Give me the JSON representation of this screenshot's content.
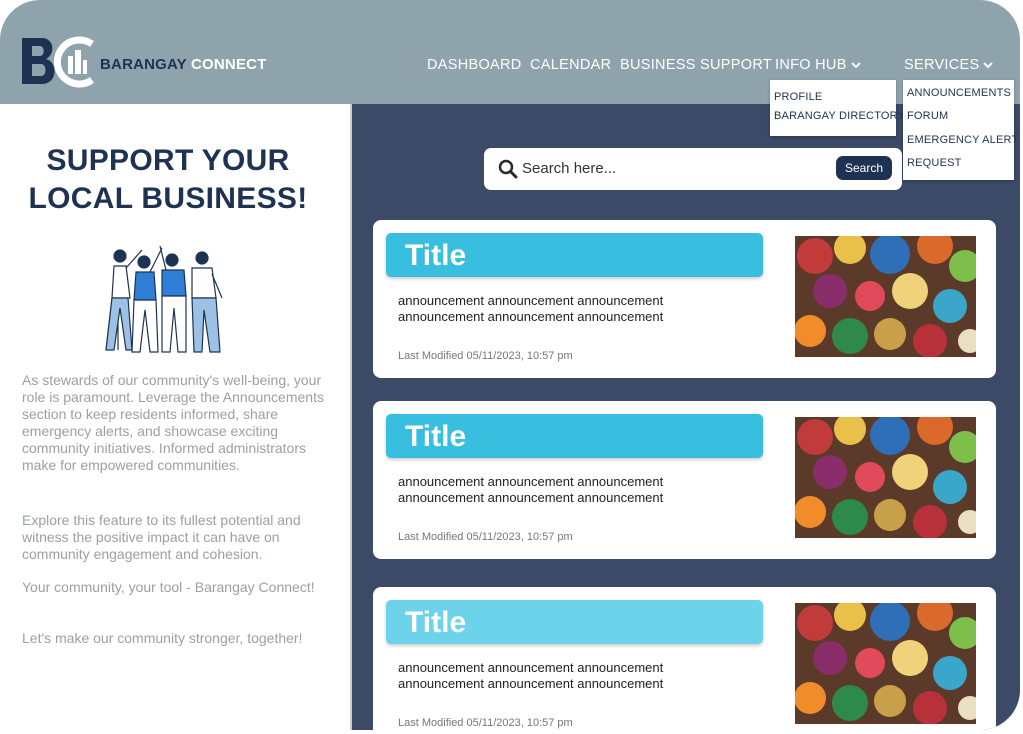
{
  "brand": {
    "name_part1": "BARANGAY",
    "name_part2": " CONNECT"
  },
  "nav": {
    "dashboard": "DASHBOARD",
    "calendar": "CALENDAR",
    "business_support": "BUSINESS SUPPORT",
    "info_hub": "INFO HUB",
    "services": "SERVICES"
  },
  "info_hub_menu": [
    "PROFILE",
    "BARANGAY DIRECTORY"
  ],
  "services_menu": [
    "ANNOUNCEMENTS",
    "FORUM",
    "EMERGENCY ALERT",
    "REQUEST"
  ],
  "sidebar": {
    "headline_line1": "SUPPORT YOUR",
    "headline_line2": "LOCAL BUSINESS!",
    "paragraphs": [
      "As stewards of our community's well-being, your role is paramount. Leverage the Announcements section to keep residents informed, share emergency alerts, and showcase exciting community initiatives. Informed administrators make for empowered communities.",
      "Explore this feature to its fullest potential and witness the positive impact it can have on community engagement and cohesion.",
      "Your community, your tool - Barangay Connect!",
      "Let's make our community stronger, together!"
    ]
  },
  "search": {
    "placeholder": "Search here...",
    "button_label": "Search"
  },
  "cards": [
    {
      "title": "Title",
      "body_line1": "announcement announcement announcement",
      "body_line2": "announcement announcement announcement",
      "modified": "Last Modified 05/11/2023, 10:57 pm",
      "title_color": "#38bfe0"
    },
    {
      "title": "Title",
      "body_line1": "announcement announcement announcement",
      "body_line2": "announcement announcement announcement",
      "modified": "Last Modified 05/11/2023, 10:57 pm",
      "title_color": "#38bfe0"
    },
    {
      "title": "Title",
      "body_line1": "announcement announcement announcement",
      "body_line2": "announcement announcement announcement",
      "modified": "Last Modified 05/11/2023, 10:57 pm",
      "title_color": "#6dd3ea"
    }
  ],
  "colors": {
    "navbar": "#8fa3ad",
    "navy": "#1e3352",
    "panel": "#3a4a67",
    "accent": "#38bfe0"
  },
  "icons": [
    "bc-logo-icon",
    "chevron-down-icon",
    "search-icon",
    "people-illustration",
    "market-photo"
  ]
}
